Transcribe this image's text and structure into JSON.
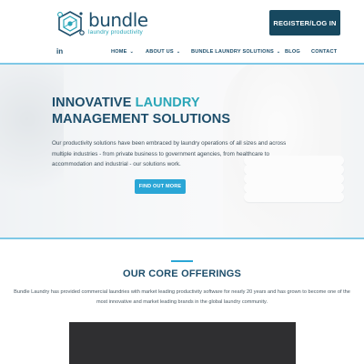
{
  "brand": {
    "name": "bundle",
    "tagline": "laundry productivity"
  },
  "header": {
    "cta_label": "REGISTER/LOG IN",
    "social_label": "in"
  },
  "nav": {
    "items": [
      {
        "label": "HOME",
        "has_dropdown": true
      },
      {
        "label": "ABOUT US",
        "has_dropdown": true
      },
      {
        "label": "BUNDLE LAUNDRY SOLUTIONS",
        "has_dropdown": true
      },
      {
        "label": "BLOG",
        "has_dropdown": false
      },
      {
        "label": "CONTACT",
        "has_dropdown": false
      }
    ]
  },
  "hero": {
    "title_part1": "INNOVATIVE ",
    "title_accent": "LAUNDRY",
    "title_part2": "MANAGEMENT SOLUTIONS",
    "copy": "Our productivity solutions have been embraced by laundry operations of all sizes and across multiple industries - from private business to government agencies, from healthcare to accommodation and industrial - our solutions work.",
    "button_label": "FIND OUT MORE"
  },
  "offerings": {
    "title": "OUR CORE OFFERINGS",
    "copy": "Bundle Laundry has provided commercial laundries with market leading productivity software for nearly 20 years and has grown to become one of the most innovative and market leading brands in the global laundry community."
  },
  "colors": {
    "navy": "#1d4e6b",
    "teal": "#2aa6b8",
    "button_blue": "#2aa6d6",
    "cta_bg": "#17485f",
    "rule": "#7fc8e6"
  },
  "icons": {
    "logo": "hexagon-molecule-icon",
    "social": "linkedin-icon",
    "dropdown": "chevron-down-icon"
  }
}
